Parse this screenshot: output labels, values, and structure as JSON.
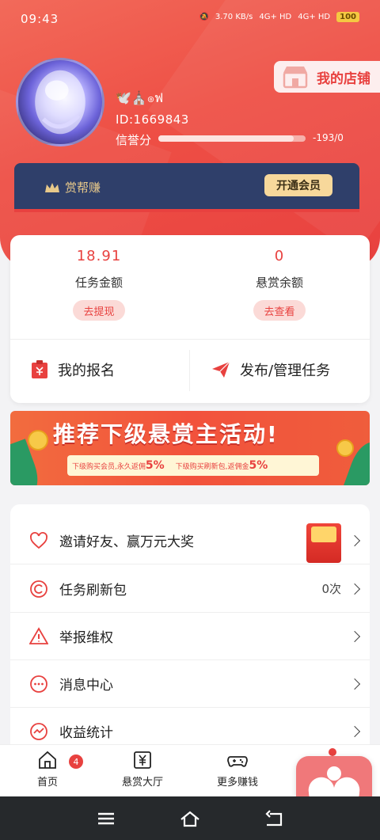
{
  "status_bar": {
    "time": "09:43",
    "speed": "3.70 KB/s",
    "network1": "4G+ HD",
    "network2": "4G+ HD",
    "battery": "100"
  },
  "profile": {
    "username": "🕊️⛪ၜฟ",
    "id": "ID:1669843",
    "credit_label": "信誉分",
    "credit_value": "-193/0",
    "credit_fill": 0.92
  },
  "shop_button": {
    "label": "我的店铺"
  },
  "vip": {
    "title": "赏帮赚",
    "button": "开通会员"
  },
  "stats": {
    "task_amount": {
      "value": "18.91",
      "label": "任务金额",
      "action": "去提现"
    },
    "reward_balance": {
      "value": "0",
      "label": "悬赏余额",
      "action": "去查看"
    }
  },
  "actions": {
    "my_signup": "我的报名",
    "publish_manage": "发布/管理任务"
  },
  "banner": {
    "headline": "推荐下级悬赏主活动!",
    "left_text": "下级购买会员,永久返佣",
    "left_pct": "5%",
    "right_text": "下级购买刷新包,返佣金",
    "right_pct": "5%"
  },
  "menu": [
    {
      "label": "邀请好友、赢万元大奖",
      "value": ""
    },
    {
      "label": "任务刷新包",
      "value": "0次"
    },
    {
      "label": "举报维权",
      "value": ""
    },
    {
      "label": "消息中心",
      "value": ""
    },
    {
      "label": "收益统计",
      "value": ""
    }
  ],
  "tabs": [
    {
      "label": "首页",
      "badge": "4"
    },
    {
      "label": "悬赏大厅"
    },
    {
      "label": "更多赚钱"
    }
  ],
  "colors": {
    "primary": "#e8413f",
    "navy": "#2f3f6a",
    "gold": "#f7d89b"
  }
}
